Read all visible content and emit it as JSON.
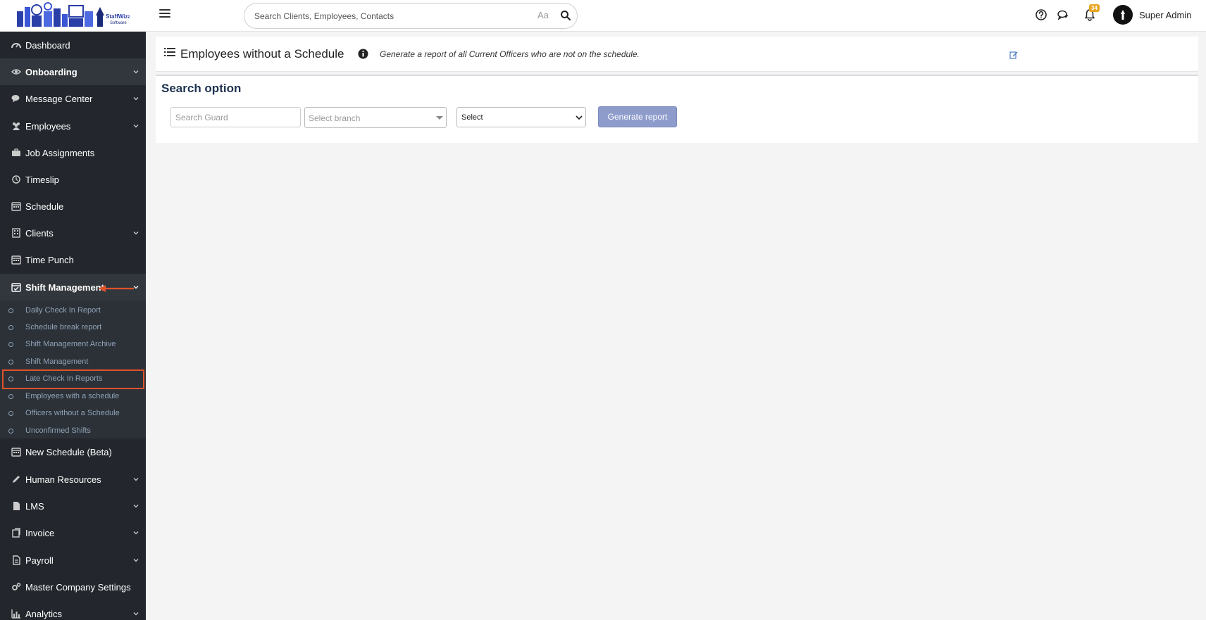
{
  "header": {
    "search_placeholder": "Search Clients, Employees, Contacts",
    "case_toggle": "Aa",
    "notification_count": "34",
    "user_name": "Super Admin"
  },
  "sidebar": {
    "items": [
      {
        "label": "Dashboard",
        "icon": "dashboard-icon"
      },
      {
        "label": "Onboarding",
        "icon": "eye-icon",
        "expandable": true,
        "active": true
      },
      {
        "label": "Message Center",
        "icon": "chat-icon",
        "expandable": true
      },
      {
        "label": "Employees",
        "icon": "users-icon",
        "expandable": true
      },
      {
        "label": "Job Assignments",
        "icon": "briefcase-icon"
      },
      {
        "label": "Timeslip",
        "icon": "clock-icon"
      },
      {
        "label": "Schedule",
        "icon": "calendar-icon"
      },
      {
        "label": "Clients",
        "icon": "building-icon",
        "expandable": true
      },
      {
        "label": "Time Punch",
        "icon": "calendar-icon"
      },
      {
        "label": "Shift Management",
        "icon": "calendar-check-icon",
        "expandable": true,
        "active": true
      },
      {
        "label": "New Schedule (Beta)",
        "icon": "calendar-icon"
      },
      {
        "label": "Human Resources",
        "icon": "pencil-icon",
        "expandable": true
      },
      {
        "label": "LMS",
        "icon": "file-icon",
        "expandable": true
      },
      {
        "label": "Invoice",
        "icon": "invoice-icon",
        "expandable": true
      },
      {
        "label": "Payroll",
        "icon": "document-icon",
        "expandable": true
      },
      {
        "label": "Master Company Settings",
        "icon": "cogs-icon"
      },
      {
        "label": "Analytics",
        "icon": "bar-chart-icon",
        "expandable": true
      }
    ],
    "submenu": [
      "Daily Check In Report",
      "Schedule break report",
      "Shift Management Archive",
      "Shift Management",
      "Late Check In Reports",
      "Employees with a schedule",
      "Officers without a Schedule",
      "Unconfirmed Shifts"
    ]
  },
  "page": {
    "title": "Employees without a Schedule",
    "description": "Generate a report of all Current Officers who are not on the schedule."
  },
  "search_panel": {
    "title": "Search option",
    "guard_placeholder": "Search Guard",
    "branch_placeholder": "Select branch",
    "select_value": "Select",
    "generate_label": "Generate report"
  },
  "colors": {
    "sidebar_bg": "#23272d",
    "submenu_bg": "#2c3138",
    "submenu_text": "#8ea2b5",
    "annotation": "#e0522a",
    "button_bg": "#8e9ccc",
    "title_color": "#1f3350",
    "badge": "#e8a420"
  }
}
